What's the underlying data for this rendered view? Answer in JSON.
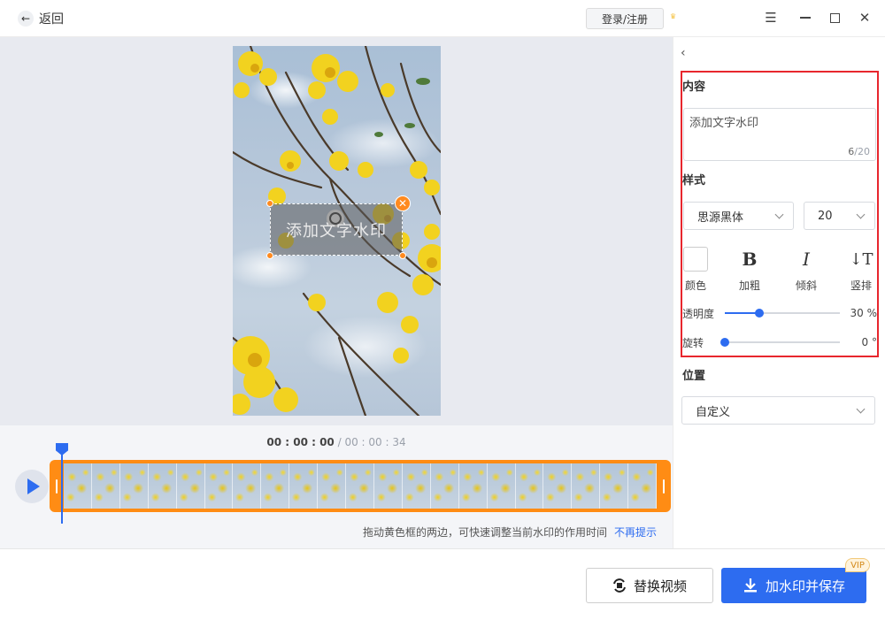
{
  "titlebar": {
    "back_label": "返回",
    "login_label": "登录/注册"
  },
  "preview": {
    "watermark_text": "添加文字水印"
  },
  "timeline": {
    "current": "00 : 00 : 00",
    "separator": " / ",
    "total": "00 : 00 : 34",
    "hint": "拖动黄色框的两边，可快速调整当前水印的作用时间",
    "dismiss": "不再提示"
  },
  "panel": {
    "content_title": "内容",
    "text_value": "添加文字水印",
    "char_count": "6",
    "char_max": "/20",
    "style_title": "样式",
    "font_family": "思源黑体",
    "font_size": "20",
    "buttons": {
      "color": "颜色",
      "bold": "加粗",
      "italic": "倾斜",
      "vertical": "竖排"
    },
    "opacity": {
      "label": "透明度",
      "value": 30,
      "display": "30 %"
    },
    "rotation": {
      "label": "旋转",
      "value": 0,
      "display": "0 °"
    },
    "position_title": "位置",
    "position_value": "自定义"
  },
  "bottom": {
    "replace_label": "替换视频",
    "save_label": "加水印并保存",
    "vip_badge": "VIP"
  },
  "colors": {
    "accent": "#2d6cf0",
    "timeline_frame": "#ff8c14",
    "highlight_box": "#e8262d"
  }
}
